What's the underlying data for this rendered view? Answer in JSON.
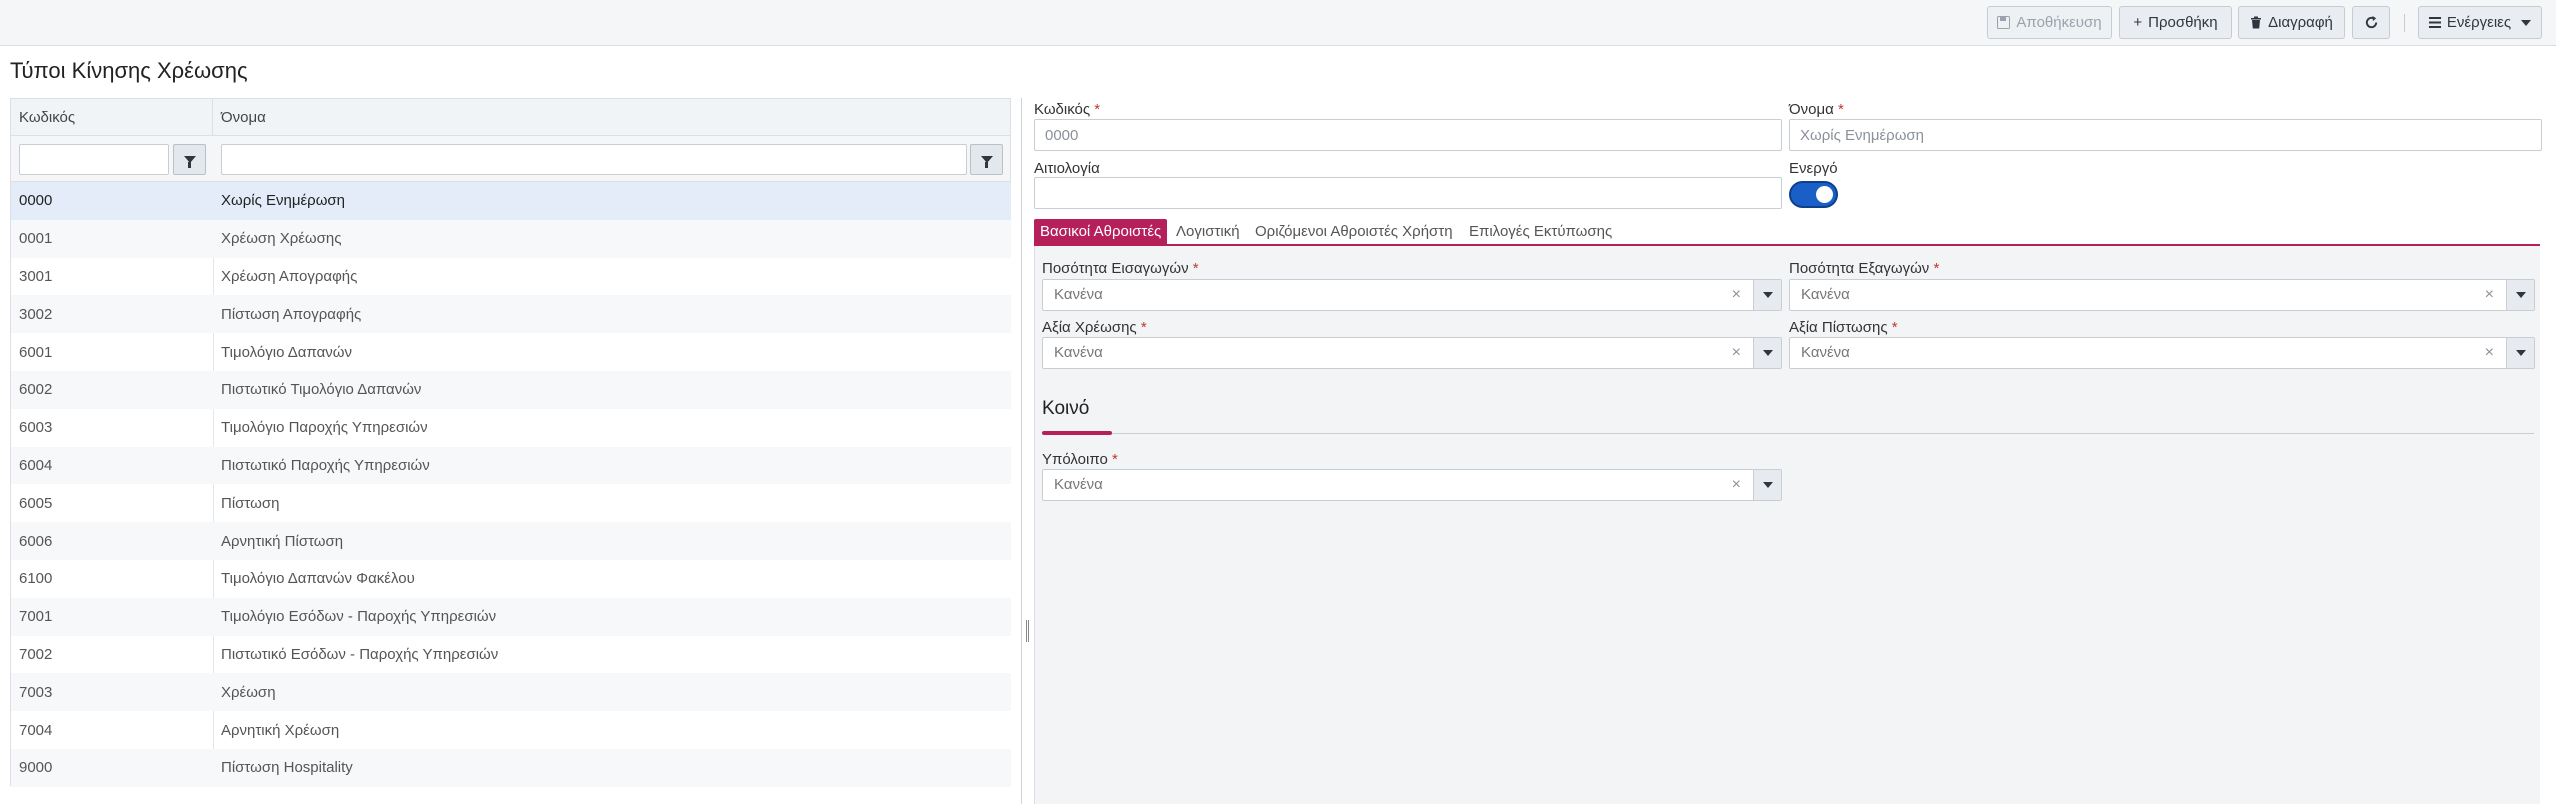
{
  "toolbar": {
    "save_label": "Αποθήκευση",
    "add_label": "Προσθήκη",
    "delete_label": "Διαγραφή",
    "actions_label": "Ενέργειες"
  },
  "page": {
    "title": "Τύποι Κίνησης Χρέωσης"
  },
  "grid": {
    "columns": [
      "Κωδικός",
      "Όνομα"
    ],
    "rows": [
      {
        "code": "0000",
        "name": "Χωρίς Ενημέρωση"
      },
      {
        "code": "0001",
        "name": "Χρέωση Χρέωσης"
      },
      {
        "code": "3001",
        "name": "Χρέωση Απογραφής"
      },
      {
        "code": "3002",
        "name": "Πίστωση Απογραφής"
      },
      {
        "code": "6001",
        "name": "Τιμολόγιο Δαπανών"
      },
      {
        "code": "6002",
        "name": "Πιστωτικό Τιμολόγιο Δαπανών"
      },
      {
        "code": "6003",
        "name": "Τιμολόγιο Παροχής Υπηρεσιών"
      },
      {
        "code": "6004",
        "name": "Πιστωτικό Παροχής Υπηρεσιών"
      },
      {
        "code": "6005",
        "name": "Πίστωση"
      },
      {
        "code": "6006",
        "name": "Αρνητική Πίστωση"
      },
      {
        "code": "6100",
        "name": "Τιμολόγιο Δαπανών Φακέλου"
      },
      {
        "code": "7001",
        "name": "Τιμολόγιο Εσόδων - Παροχής Υπηρεσιών"
      },
      {
        "code": "7002",
        "name": "Πιστωτικό Εσόδων - Παροχής Υπηρεσιών"
      },
      {
        "code": "7003",
        "name": "Χρέωση"
      },
      {
        "code": "7004",
        "name": "Αρνητική Χρέωση"
      },
      {
        "code": "9000",
        "name": "Πίστωση Hospitality"
      }
    ]
  },
  "form": {
    "code_label": "Κωδικός",
    "code_value": "0000",
    "name_label": "Όνομα",
    "name_value": "Χωρίς Ενημέρωση",
    "reason_label": "Αιτιολογία",
    "reason_value": "",
    "active_label": "Ενεργό",
    "required_mark": "*"
  },
  "tabs": [
    "Βασικοί Αθροιστές",
    "Λογιστική",
    "Οριζόμενοι Αθροιστές Χρήστη",
    "Επιλογές Εκτύπωσης"
  ],
  "basic_totals": {
    "import_qty_label": "Ποσότητα Εισαγωγών",
    "export_qty_label": "Ποσότητα Εξαγωγών",
    "charge_value_label": "Αξία Χρέωσης",
    "credit_value_label": "Αξία Πίστωσης",
    "none_value": "Κανένα",
    "clear_glyph": "×"
  },
  "common": {
    "title": "Κοινό",
    "balance_label": "Υπόλοιπο"
  },
  "colors": {
    "accent": "#b51f5a",
    "toggle_on": "#1a5fc8"
  }
}
